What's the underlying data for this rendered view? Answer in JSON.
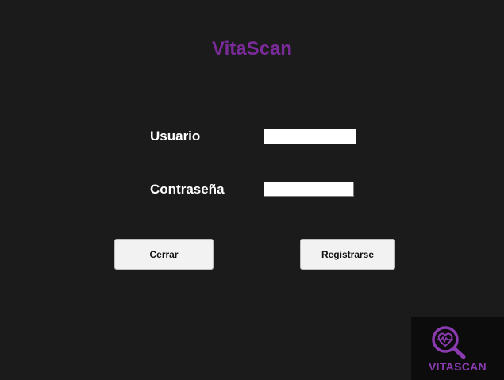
{
  "app": {
    "title": "VitaScan"
  },
  "form": {
    "username_label": "Usuario",
    "username_value": "",
    "password_label": "Contraseña",
    "password_value": ""
  },
  "buttons": {
    "close_label": "Cerrar",
    "register_label": "Registrarse"
  },
  "logo": {
    "icon": "magnifier-heart-icon",
    "text": "VITASCAN"
  },
  "colors": {
    "background": "#1b1b1b",
    "accent": "#7b2a9a",
    "logo_background": "#0c0c0c",
    "button_background": "#f2f2f2"
  }
}
